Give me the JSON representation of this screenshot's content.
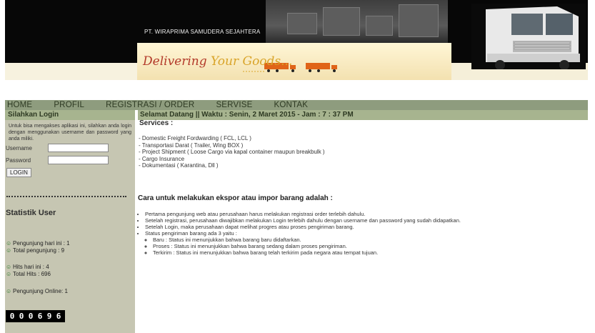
{
  "header": {
    "company": "PT. WIRAPRIMA SAMUDERA SEJAHTERA",
    "slogan_part1": "Delivering ",
    "slogan_part2": "Your Goods..."
  },
  "nav": {
    "items": [
      "HOME",
      "PROFIL",
      "REGISTRASI / ORDER",
      "SERVISE",
      "KONTAK"
    ]
  },
  "sidebar": {
    "login_title": "Silahkan Login",
    "login_desc": "Untuk bisa mengakses aplikasi ini, silahkan anda login dengan menggunakan username dan password yang anda miliki.",
    "username_label": "Username",
    "password_label": "Password",
    "login_button": "LOGIN",
    "stats_title": "Statistik User",
    "stats": [
      "Pengunjung hari ini : 1",
      "Total pengunjung : 9",
      "Hits hari ini : 4",
      "Total Hits : 696",
      "Pengunjung Online: 1"
    ],
    "counter_digits": [
      "0",
      "0",
      "0",
      "6",
      "9",
      "6"
    ]
  },
  "main": {
    "welcome": "Selamat Datang || Waktu : Senin, 2 Maret 2015  - Jam :  7 : 37 PM",
    "services_title": "Services :",
    "services": [
      "- Domestic Freight Fordwarding ( FCL, LCL )",
      "- Transportasi Darat ( Trailer, Wing BOX )",
      "- Project Shipment ( Loose Cargo via kapal container maupun breakbulk )",
      "- Cargo Insurance",
      "- Dokumentasi ( Karantina, Dll )"
    ],
    "cara_title": "Cara untuk melakukan ekspor atau impor barang adalah :",
    "cara_steps": [
      "Pertama pengunjung web atau perusahaan harus melakukan registrasi order terlebih dahulu.",
      "Setelah registrasi, perusahaan diwajibkan melakukan Login terlebih dahulu dengan username dan password yang sudah didapatkan.",
      "Setelah Login, maka perusahaan dapat melihat progres atau proses pengiriman barang.",
      "Status pengiriman barang ada 3 yaitu :"
    ],
    "status_items": [
      "Baru : Status ini menunjukkan bahwa barang baru didaftarkan.",
      "Proses : Status ini menunjukkan bahwa barang sedang dalam proses pengiriman.",
      "Terkirim : Status ini menunjukkan bahwa barang telah terkirim pada negara atau tempat tujuan."
    ]
  }
}
